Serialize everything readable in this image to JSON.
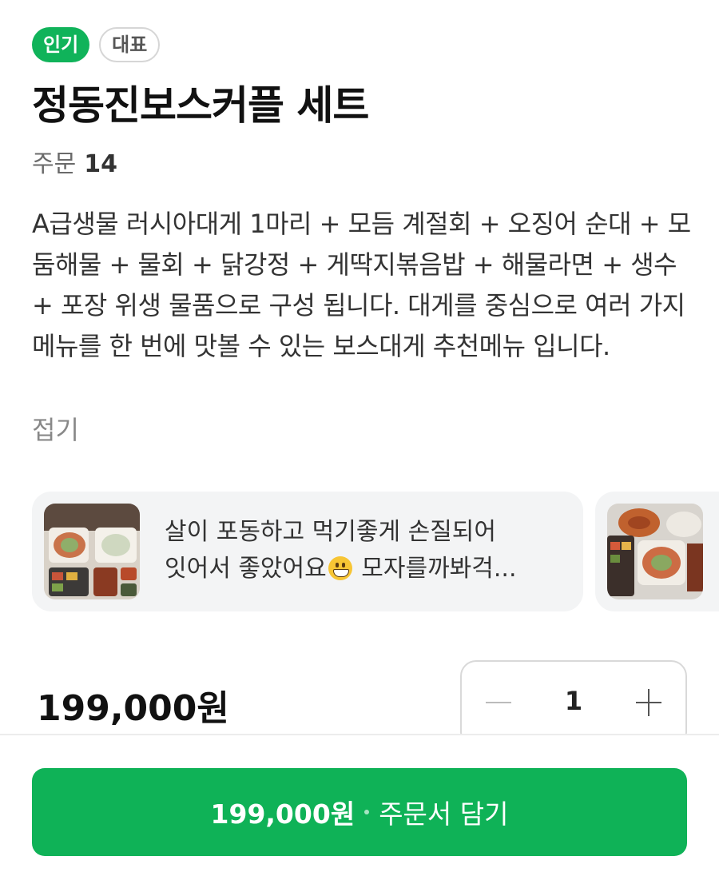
{
  "badges": {
    "popular": "인기",
    "representative": "대표"
  },
  "menu": {
    "title": "정동진보스커플 세트",
    "orders_label": "주문",
    "orders_count": "14",
    "description": "A급생물 러시아대게 1마리 + 모듬 계절회 + 오징어 순대 + 모둠해물 + 물회 + 닭강정 + 게딱지볶음밥 + 해물라면 + 생수 + 포장 위생 물품으로 구성 됩니다. 대게를 중심으로 여러 가지 메뉴를 한 번에 맛볼 수 있는 보스대게 추천메뉴 입니다.",
    "fold_label": "접기"
  },
  "reviews": [
    {
      "text_line1": "살이 포동하고 먹기좋게 손질되어",
      "text_line2a": "잇어서 좋았어요",
      "emoji": "grinning-face",
      "text_line2b": " 모자를까봐걱..."
    }
  ],
  "price": {
    "amount": "199,000원"
  },
  "quantity": {
    "value": "1"
  },
  "cta": {
    "price": "199,000원",
    "label": "주문서 담기"
  },
  "colors": {
    "accent": "#0fb257",
    "badge_green": "#10b35a",
    "text": "#1f1f1f"
  }
}
